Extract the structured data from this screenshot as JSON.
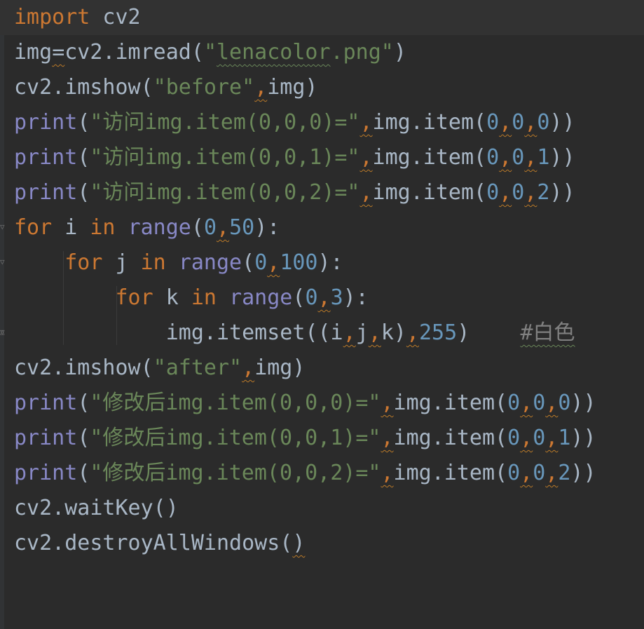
{
  "colors": {
    "background": "#2b2b2b",
    "keyword": "#cc7832",
    "builtin": "#8888c6",
    "string": "#6a8759",
    "number": "#6897bb",
    "text": "#a9b7c6",
    "comment": "#808080"
  },
  "lines": [
    {
      "current": true,
      "indent": 0,
      "tokens": [
        {
          "t": "import",
          "c": "keyword"
        },
        {
          "t": " cv2",
          "c": "text"
        }
      ]
    },
    {
      "indent": 0,
      "tokens": [
        {
          "t": "img",
          "c": "text"
        },
        {
          "t": "=",
          "c": "text",
          "sq": true
        },
        {
          "t": "cv2.imread(",
          "c": "text"
        },
        {
          "t": "\"",
          "c": "string"
        },
        {
          "t": "lenacolor",
          "c": "string",
          "sqg": true
        },
        {
          "t": ".png\"",
          "c": "string"
        },
        {
          "t": ")",
          "c": "text"
        }
      ]
    },
    {
      "indent": 0,
      "tokens": [
        {
          "t": "cv2.imshow(",
          "c": "text"
        },
        {
          "t": "\"before\"",
          "c": "string"
        },
        {
          "t": ",",
          "c": "keyword",
          "sq": true
        },
        {
          "t": "img)",
          "c": "text"
        }
      ]
    },
    {
      "indent": 0,
      "tokens": [
        {
          "t": "print",
          "c": "builtin"
        },
        {
          "t": "(",
          "c": "text"
        },
        {
          "t": "\"访问img.item(0,0,0)=\"",
          "c": "string"
        },
        {
          "t": ",",
          "c": "keyword",
          "sq": true
        },
        {
          "t": "img.item(",
          "c": "text"
        },
        {
          "t": "0",
          "c": "number"
        },
        {
          "t": ",",
          "c": "keyword",
          "sq": true
        },
        {
          "t": "0",
          "c": "number"
        },
        {
          "t": ",",
          "c": "keyword",
          "sq": true
        },
        {
          "t": "0",
          "c": "number"
        },
        {
          "t": "))",
          "c": "text"
        }
      ]
    },
    {
      "indent": 0,
      "tokens": [
        {
          "t": "print",
          "c": "builtin"
        },
        {
          "t": "(",
          "c": "text"
        },
        {
          "t": "\"访问img.item(0,0,1)=\"",
          "c": "string"
        },
        {
          "t": ",",
          "c": "keyword",
          "sq": true
        },
        {
          "t": "img.item(",
          "c": "text"
        },
        {
          "t": "0",
          "c": "number"
        },
        {
          "t": ",",
          "c": "keyword",
          "sq": true
        },
        {
          "t": "0",
          "c": "number"
        },
        {
          "t": ",",
          "c": "keyword",
          "sq": true
        },
        {
          "t": "1",
          "c": "number"
        },
        {
          "t": "))",
          "c": "text"
        }
      ]
    },
    {
      "indent": 0,
      "tokens": [
        {
          "t": "print",
          "c": "builtin"
        },
        {
          "t": "(",
          "c": "text"
        },
        {
          "t": "\"访问img.item(0,0,2)=\"",
          "c": "string"
        },
        {
          "t": ",",
          "c": "keyword",
          "sq": true
        },
        {
          "t": "img.item(",
          "c": "text"
        },
        {
          "t": "0",
          "c": "number"
        },
        {
          "t": ",",
          "c": "keyword",
          "sq": true
        },
        {
          "t": "0",
          "c": "number"
        },
        {
          "t": ",",
          "c": "keyword",
          "sq": true
        },
        {
          "t": "2",
          "c": "number"
        },
        {
          "t": "))",
          "c": "text"
        }
      ]
    },
    {
      "indent": 0,
      "fold": true,
      "tokens": [
        {
          "t": "for",
          "c": "keyword"
        },
        {
          "t": " i ",
          "c": "text"
        },
        {
          "t": "in",
          "c": "keyword"
        },
        {
          "t": " ",
          "c": "text"
        },
        {
          "t": "range",
          "c": "builtin"
        },
        {
          "t": "(",
          "c": "text"
        },
        {
          "t": "0",
          "c": "number"
        },
        {
          "t": ",",
          "c": "keyword",
          "sq": true
        },
        {
          "t": "50",
          "c": "number"
        },
        {
          "t": "):",
          "c": "text"
        }
      ]
    },
    {
      "indent": 1,
      "fold": true,
      "tokens": [
        {
          "t": "for",
          "c": "keyword"
        },
        {
          "t": " j ",
          "c": "text"
        },
        {
          "t": "in",
          "c": "keyword"
        },
        {
          "t": " ",
          "c": "text"
        },
        {
          "t": "range",
          "c": "builtin"
        },
        {
          "t": "(",
          "c": "text"
        },
        {
          "t": "0",
          "c": "number"
        },
        {
          "t": ",",
          "c": "keyword",
          "sq": true
        },
        {
          "t": "100",
          "c": "number"
        },
        {
          "t": "):",
          "c": "text"
        }
      ]
    },
    {
      "indent": 2,
      "tokens": [
        {
          "t": "for",
          "c": "keyword"
        },
        {
          "t": " k ",
          "c": "text"
        },
        {
          "t": "in",
          "c": "keyword"
        },
        {
          "t": " ",
          "c": "text"
        },
        {
          "t": "range",
          "c": "builtin"
        },
        {
          "t": "(",
          "c": "text"
        },
        {
          "t": "0",
          "c": "number"
        },
        {
          "t": ",",
          "c": "keyword",
          "sq": true
        },
        {
          "t": "3",
          "c": "number"
        },
        {
          "t": "):",
          "c": "text"
        }
      ]
    },
    {
      "indent": 3,
      "fold": true,
      "tokens": [
        {
          "t": "img.itemset((i",
          "c": "text"
        },
        {
          "t": ",",
          "c": "keyword",
          "sq": true
        },
        {
          "t": "j",
          "c": "text"
        },
        {
          "t": ",",
          "c": "keyword",
          "sq": true
        },
        {
          "t": "k)",
          "c": "text"
        },
        {
          "t": ",",
          "c": "keyword",
          "sq": true
        },
        {
          "t": "255",
          "c": "number"
        },
        {
          "t": ")    ",
          "c": "text"
        },
        {
          "t": "#白色",
          "c": "comment",
          "sqg": true
        }
      ]
    },
    {
      "indent": 0,
      "tokens": [
        {
          "t": "cv2.imshow(",
          "c": "text"
        },
        {
          "t": "\"after\"",
          "c": "string"
        },
        {
          "t": ",",
          "c": "keyword",
          "sq": true
        },
        {
          "t": "img)",
          "c": "text"
        }
      ]
    },
    {
      "indent": 0,
      "tokens": [
        {
          "t": "print",
          "c": "builtin"
        },
        {
          "t": "(",
          "c": "text"
        },
        {
          "t": "\"修改后img.item(0,0,0)=\"",
          "c": "string"
        },
        {
          "t": ",",
          "c": "keyword",
          "sq": true
        },
        {
          "t": "img.item(",
          "c": "text"
        },
        {
          "t": "0",
          "c": "number"
        },
        {
          "t": ",",
          "c": "keyword",
          "sq": true
        },
        {
          "t": "0",
          "c": "number"
        },
        {
          "t": ",",
          "c": "keyword",
          "sq": true
        },
        {
          "t": "0",
          "c": "number"
        },
        {
          "t": "))",
          "c": "text"
        }
      ]
    },
    {
      "indent": 0,
      "tokens": [
        {
          "t": "print",
          "c": "builtin"
        },
        {
          "t": "(",
          "c": "text"
        },
        {
          "t": "\"修改后img.item(0,0,1)=\"",
          "c": "string"
        },
        {
          "t": ",",
          "c": "keyword",
          "sq": true
        },
        {
          "t": "img.item(",
          "c": "text"
        },
        {
          "t": "0",
          "c": "number"
        },
        {
          "t": ",",
          "c": "keyword",
          "sq": true
        },
        {
          "t": "0",
          "c": "number"
        },
        {
          "t": ",",
          "c": "keyword",
          "sq": true
        },
        {
          "t": "1",
          "c": "number"
        },
        {
          "t": "))",
          "c": "text"
        }
      ]
    },
    {
      "indent": 0,
      "tokens": [
        {
          "t": "print",
          "c": "builtin"
        },
        {
          "t": "(",
          "c": "text"
        },
        {
          "t": "\"修改后img.item(0,0,2)=\"",
          "c": "string"
        },
        {
          "t": ",",
          "c": "keyword",
          "sq": true
        },
        {
          "t": "img.item(",
          "c": "text"
        },
        {
          "t": "0",
          "c": "number"
        },
        {
          "t": ",",
          "c": "keyword",
          "sq": true
        },
        {
          "t": "0",
          "c": "number"
        },
        {
          "t": ",",
          "c": "keyword",
          "sq": true
        },
        {
          "t": "2",
          "c": "number"
        },
        {
          "t": "))",
          "c": "text"
        }
      ]
    },
    {
      "indent": 0,
      "tokens": [
        {
          "t": "cv2.waitKey()",
          "c": "text"
        }
      ]
    },
    {
      "indent": 0,
      "tokens": [
        {
          "t": "cv2.destroyAllWindows(",
          "c": "text"
        },
        {
          "t": ")",
          "c": "text",
          "sq": true
        }
      ]
    }
  ]
}
